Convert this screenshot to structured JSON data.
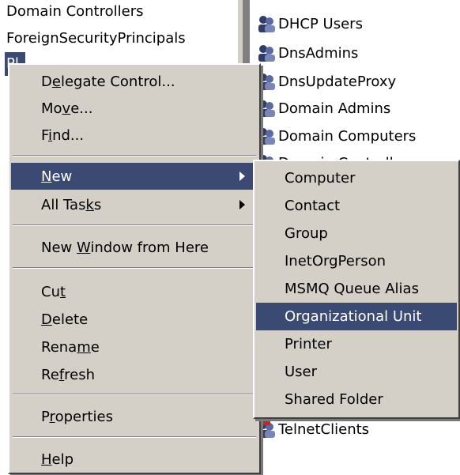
{
  "tree": {
    "items": [
      {
        "label": "Domain Controllers"
      },
      {
        "label": "ForeignSecurityPrincipals"
      },
      {
        "label": "Pl"
      }
    ]
  },
  "list": {
    "items": [
      {
        "label": "DHCP Users"
      },
      {
        "label": "DnsAdmins"
      },
      {
        "label": "DnsUpdateProxy"
      },
      {
        "label": "Domain Admins"
      },
      {
        "label": "Domain Computers"
      },
      {
        "label": "Domain Controllers"
      },
      {
        "label": "TelnetClients"
      }
    ]
  },
  "context_menu": {
    "items": [
      {
        "pre": "D",
        "u": "e",
        "post": "legate Control..."
      },
      {
        "pre": "Mo",
        "u": "v",
        "post": "e..."
      },
      {
        "pre": "F",
        "u": "i",
        "post": "nd..."
      },
      {
        "pre": "",
        "u": "N",
        "post": "ew"
      },
      {
        "pre": "All Tas",
        "u": "k",
        "post": "s"
      },
      {
        "pre": "New ",
        "u": "W",
        "post": "indow from Here"
      },
      {
        "pre": "Cu",
        "u": "t",
        "post": ""
      },
      {
        "pre": "",
        "u": "D",
        "post": "elete"
      },
      {
        "pre": "Rena",
        "u": "m",
        "post": "e"
      },
      {
        "pre": "Re",
        "u": "f",
        "post": "resh"
      },
      {
        "pre": "P",
        "u": "r",
        "post": "operties"
      },
      {
        "pre": "",
        "u": "H",
        "post": "elp"
      }
    ]
  },
  "submenu": {
    "items": [
      {
        "label": "Computer"
      },
      {
        "label": "Contact"
      },
      {
        "label": "Group"
      },
      {
        "label": "InetOrgPerson"
      },
      {
        "label": "MSMQ Queue Alias"
      },
      {
        "label": "Organizational Unit"
      },
      {
        "label": "Printer"
      },
      {
        "label": "User"
      },
      {
        "label": "Shared Folder"
      }
    ]
  },
  "colors": {
    "highlight": "#3b4a72",
    "menu_bg": "#d4d0c8"
  },
  "icons": {
    "group": "group-users-icon"
  }
}
